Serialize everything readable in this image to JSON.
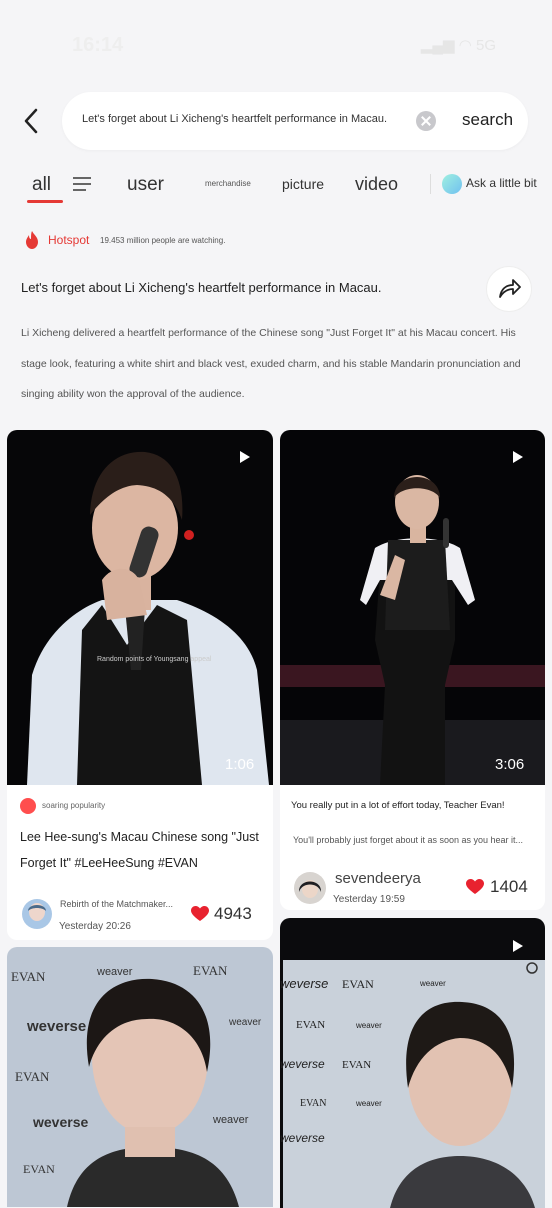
{
  "status_bar": {
    "time": "16:14",
    "system": "▂▄▆ ◠ 5G"
  },
  "search": {
    "query": "Let's forget about Li Xicheng's heartfelt performance in Macau.",
    "button": "search"
  },
  "tabs": {
    "all": "all",
    "user": "user",
    "merchandise": "merchandise",
    "picture": "picture",
    "video": "video",
    "ask": "Ask a little bit"
  },
  "hotspot": {
    "label": "Hotspot",
    "watching": "19.453 million people are watching."
  },
  "topic": {
    "title": "Let's forget about Li Xicheng's heartfelt performance in Macau.",
    "description": "Li Xicheng delivered a heartfelt performance of the Chinese song \"Just Forget It\" at his Macau concert. His stage look, featuring a white shirt and black vest, exuded charm, and his stable Mandarin pronunciation and singing ability won the approval of the audience."
  },
  "cards": [
    {
      "duration": "1:06",
      "badge": "soaring popularity",
      "title": "Lee Hee-sung's Macau Chinese song \"Just Forget It\" #LeeHeeSung #EVAN",
      "author": "Rebirth of the Matchmaker...",
      "time": "Yesterday 20:26",
      "likes": "4943"
    },
    {
      "duration": "3:06",
      "title": "You really put in a lot of effort today, Teacher Evan!",
      "subtitle": "You'll probably just forget about it as soon as you hear it...",
      "author": "sevendeerya",
      "time": "Yesterday 19:59",
      "likes": "1404"
    }
  ],
  "backdrop_words": [
    "EVAN",
    "weaver",
    "weverse"
  ],
  "colors": {
    "accent": "#e53935",
    "background": "#f5f5f7"
  }
}
